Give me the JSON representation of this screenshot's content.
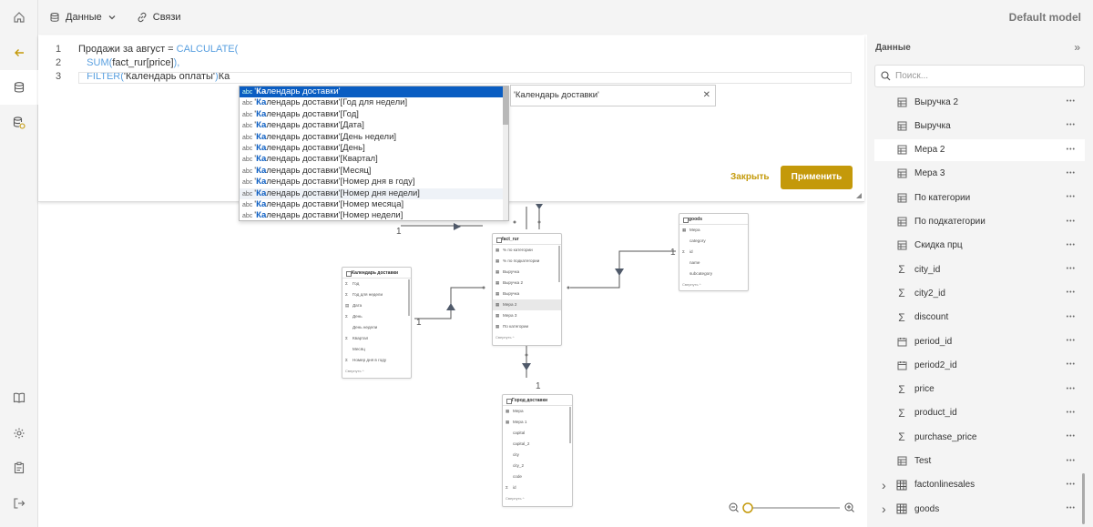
{
  "topbar": {
    "data_label": "Данные",
    "links_label": "Связи",
    "model_name": "Default model"
  },
  "editor": {
    "lines": [
      {
        "num": "1",
        "parts": [
          {
            "t": "Продажи за август = ",
            "kw": false
          },
          {
            "t": "CALCULATE(",
            "kw": true
          }
        ]
      },
      {
        "num": "2",
        "parts": [
          {
            "t": "   ",
            "kw": false
          },
          {
            "t": "SUM(",
            "kw": true
          },
          {
            "t": "fact_rur[price]",
            "kw": false
          },
          {
            "t": "),",
            "kw": true
          }
        ]
      },
      {
        "num": "3",
        "parts": [
          {
            "t": "   ",
            "kw": false
          },
          {
            "t": "FILTER(",
            "kw": true
          },
          {
            "t": "'Календарь оплаты'",
            "kw": false
          },
          {
            "t": ")",
            "kw": true
          },
          {
            "t": "Ка",
            "kw": false
          }
        ]
      }
    ],
    "autocomplete": [
      {
        "prefix": "Ка",
        "rest": "лендарь доставки'",
        "lead": "'"
      },
      {
        "prefix": "Ка",
        "rest": "лендарь доставки'[Год для недели]",
        "lead": "'"
      },
      {
        "prefix": "Ка",
        "rest": "лендарь доставки'[Год]",
        "lead": "'"
      },
      {
        "prefix": "Ка",
        "rest": "лендарь доставки'[Дата]",
        "lead": "'"
      },
      {
        "prefix": "Ка",
        "rest": "лендарь доставки'[День недели]",
        "lead": "'"
      },
      {
        "prefix": "Ка",
        "rest": "лендарь доставки'[День]",
        "lead": "'"
      },
      {
        "prefix": "Ка",
        "rest": "лендарь доставки'[Квартал]",
        "lead": "'"
      },
      {
        "prefix": "Ка",
        "rest": "лендарь доставки'[Месяц]",
        "lead": "'"
      },
      {
        "prefix": "Ка",
        "rest": "лендарь доставки'[Номер дня в году]",
        "lead": "'"
      },
      {
        "prefix": "Ка",
        "rest": "лендарь доставки'[Номер дня недели]",
        "lead": "'"
      },
      {
        "prefix": "Ка",
        "rest": "лендарь доставки'[Номер месяца]",
        "lead": "'"
      },
      {
        "prefix": "Ка",
        "rest": "лендарь доставки'[Номер недели]",
        "lead": "'"
      }
    ],
    "abc": "abc",
    "tooltip": "'Календарь доставки'",
    "close_label": "Закрыть",
    "apply_label": "Применить"
  },
  "diagram": {
    "tables": [
      {
        "title": "fact_rur",
        "rows": [
          {
            "icon": "▦",
            "t": "% по категории"
          },
          {
            "icon": "▦",
            "t": "% по подкатегории"
          },
          {
            "icon": "▦",
            "t": "Выручка"
          },
          {
            "icon": "▦",
            "t": "Выручка 2"
          },
          {
            "icon": "▦",
            "t": "Выручка"
          },
          {
            "icon": "▦",
            "t": "Мера 2",
            "sel": true
          },
          {
            "icon": "▦",
            "t": "Мера 3"
          },
          {
            "icon": "▦",
            "t": "По категории"
          }
        ],
        "footer": "Свернуть ^"
      },
      {
        "title": "goods",
        "rows": [
          {
            "icon": "▦",
            "t": "Мера"
          },
          {
            "icon": "",
            "t": "category"
          },
          {
            "icon": "Σ",
            "t": "id"
          },
          {
            "icon": "",
            "t": "name"
          },
          {
            "icon": "",
            "t": "subcategory"
          }
        ],
        "footer": "Свернуть ^"
      },
      {
        "title": "Календарь доставки",
        "rows": [
          {
            "icon": "Σ",
            "t": "Год"
          },
          {
            "icon": "Σ",
            "t": "Год для недели"
          },
          {
            "icon": "▤",
            "t": "Дата"
          },
          {
            "icon": "Σ",
            "t": "День"
          },
          {
            "icon": "",
            "t": "День недели"
          },
          {
            "icon": "Σ",
            "t": "Квартал"
          },
          {
            "icon": "",
            "t": "Месяц"
          },
          {
            "icon": "Σ",
            "t": "Номер дня в году"
          }
        ],
        "footer": "Свернуть ^"
      },
      {
        "title": "Город доставки",
        "rows": [
          {
            "icon": "▦",
            "t": "Мера"
          },
          {
            "icon": "▦",
            "t": "Мера 1"
          },
          {
            "icon": "",
            "t": "capital"
          },
          {
            "icon": "",
            "t": "capital_2"
          },
          {
            "icon": "",
            "t": "city"
          },
          {
            "icon": "",
            "t": "city_2"
          },
          {
            "icon": "",
            "t": "code"
          },
          {
            "icon": "Σ",
            "t": "id"
          }
        ],
        "footer": "Свернуть ^"
      }
    ],
    "one": "1"
  },
  "panel": {
    "title": "Данные",
    "search_placeholder": "Поиск...",
    "items": [
      {
        "type": "measure",
        "label": "Выручка 2"
      },
      {
        "type": "measure",
        "label": "Выручка"
      },
      {
        "type": "measure",
        "label": "Мера 2",
        "selected": true
      },
      {
        "type": "measure",
        "label": "Мера 3"
      },
      {
        "type": "measure",
        "label": "По категории"
      },
      {
        "type": "measure",
        "label": "По подкатегории"
      },
      {
        "type": "measure",
        "label": "Скидка прц"
      },
      {
        "type": "sum",
        "label": "city_id"
      },
      {
        "type": "sum",
        "label": "city2_id"
      },
      {
        "type": "sum",
        "label": "discount"
      },
      {
        "type": "date",
        "label": "period_id"
      },
      {
        "type": "date",
        "label": "period2_id"
      },
      {
        "type": "sum",
        "label": "price"
      },
      {
        "type": "sum",
        "label": "product_id"
      },
      {
        "type": "sum",
        "label": "purchase_price"
      },
      {
        "type": "measure",
        "label": "Test"
      },
      {
        "type": "table",
        "label": "factonlinesales"
      },
      {
        "type": "table",
        "label": "goods"
      }
    ]
  }
}
